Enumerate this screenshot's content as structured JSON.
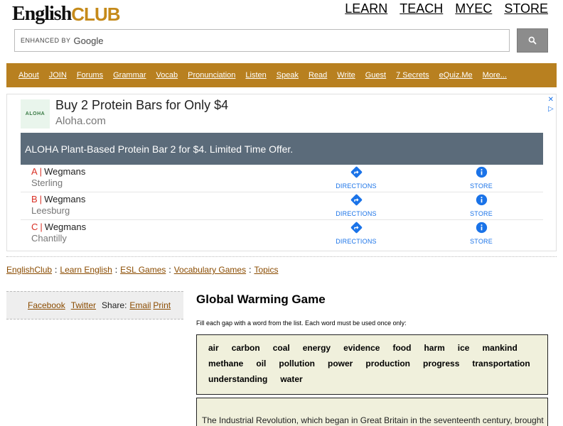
{
  "logo": {
    "english": "English",
    "club": "CLUB"
  },
  "topnav": [
    "LEARN",
    "TEACH",
    "MYEC",
    "STORE"
  ],
  "search": {
    "enhanced": "ENHANCED BY",
    "google": "Google",
    "button_icon": "search-icon"
  },
  "menu": [
    "About",
    "JOIN",
    "Forums",
    "Grammar",
    "Vocab",
    "Pronunciation",
    "Listen",
    "Speak",
    "Read",
    "Write",
    "Guest",
    "7 Secrets",
    "eQuiz.Me",
    "More..."
  ],
  "ad": {
    "logo_text": "ALOHA",
    "headline": "Buy 2 Protein Bars for Only $4",
    "domain": "Aloha.com",
    "banner": "ALOHA Plant-Based Protein Bar 2 for $4. Limited Time Offer.",
    "locations": [
      {
        "letter": "A",
        "name": "Wegmans",
        "city": "Sterling"
      },
      {
        "letter": "B",
        "name": "Wegmans",
        "city": "Leesburg"
      },
      {
        "letter": "C",
        "name": "Wegmans",
        "city": "Chantilly"
      }
    ],
    "directions_label": "DIRECTIONS",
    "store_label": "STORE",
    "sep": "|",
    "accent_color": "#1a73e8",
    "banner_color": "#5b6b7a"
  },
  "breadcrumb": [
    "EnglishClub",
    "Learn English",
    "ESL Games",
    "Vocabulary Games",
    "Topics"
  ],
  "breadcrumb_sep": ":",
  "share": {
    "facebook": "Facebook",
    "twitter": "Twitter",
    "label": "Share:",
    "email": "Email",
    "print": "Print"
  },
  "article": {
    "title": "Global Warming Game",
    "instructions": "Fill each gap with a word from the list. Each word must be used once only:",
    "words": [
      "air",
      "carbon",
      "coal",
      "energy",
      "evidence",
      "food",
      "harm",
      "ice",
      "mankind",
      "methane",
      "oil",
      "pollution",
      "power",
      "production",
      "progress",
      "transportation",
      "understanding",
      "water"
    ],
    "passage_start": "The Industrial Revolution, which began in Great Britain in the seventeenth century, brought"
  },
  "colors": {
    "menu_bar": "#b88020",
    "link": "#8a4b00",
    "word_box": "#f0f0dc"
  }
}
